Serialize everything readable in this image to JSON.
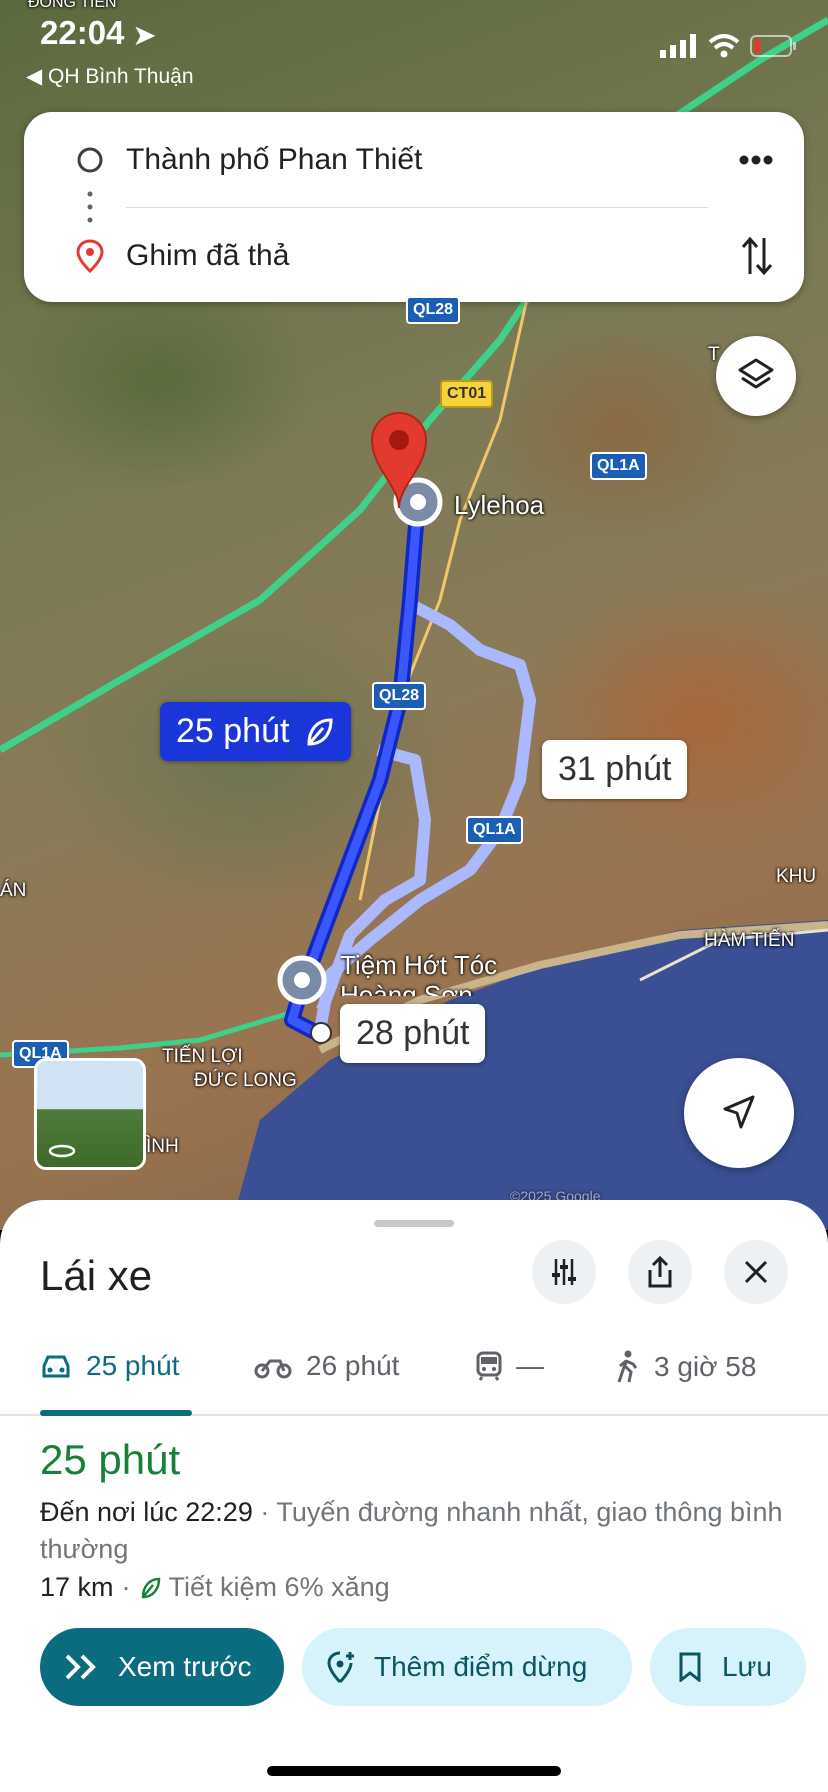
{
  "status_bar": {
    "time": "22:04",
    "back_app": "◀ QH Bình Thuận"
  },
  "search": {
    "origin": "Thành phố Phan Thiết",
    "destination": "Ghim đã thả"
  },
  "map": {
    "shields": [
      "QL28",
      "CT01",
      "QL1A",
      "QL28",
      "QL1A",
      "QL1A"
    ],
    "places": [
      "Lylehoa",
      "Tiệm Hớt Tóc Hoàng Sơn",
      "TIẾN LỢI",
      "ĐỨC LONG",
      "HÀM TIẾN",
      "KHU",
      "ÁN",
      "ÌNH",
      "ĐÔNG TIẾN",
      "T"
    ],
    "route_times": {
      "selected": "25 phút",
      "alt1": "31 phút",
      "alt2": "28 phút"
    },
    "copyright": "©2025 Google"
  },
  "sheet": {
    "title": "Lái xe",
    "tabs": [
      {
        "mode": "car",
        "label": "25 phút"
      },
      {
        "mode": "motorbike",
        "label": "26 phút"
      },
      {
        "mode": "transit",
        "label": "—"
      },
      {
        "mode": "walk",
        "label": "3 giờ 58"
      }
    ],
    "duration": "25 phút",
    "arrival": "Đến nơi lúc 22:29",
    "description": " · Tuyến đường nhanh nhất, giao thông bình thường",
    "distance": "17 km",
    "separator": " · ",
    "fuel": "Tiết kiệm 6% xăng",
    "buttons": {
      "preview": "Xem trước",
      "add_stop": "Thêm điểm dừng",
      "save": "Lưu"
    }
  },
  "colors": {
    "accent": "#0b6c7f",
    "route": "#1a36d8",
    "green": "#188038"
  }
}
